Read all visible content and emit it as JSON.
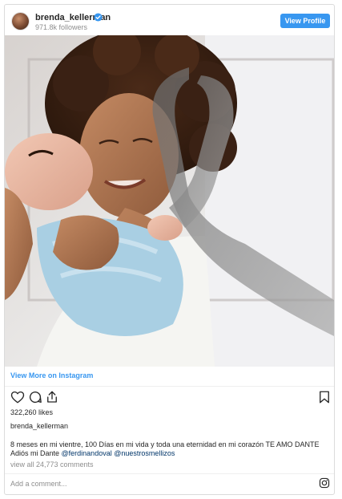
{
  "header": {
    "username": "brenda_kellerman",
    "followers": "971.8k followers",
    "view_profile_label": "View Profile",
    "verified_icon": "verified-badge-icon"
  },
  "post": {
    "view_more_label": "View More on Instagram",
    "likes": "322,260 likes",
    "author": "brenda_kellerman",
    "caption_text": "8 meses en mi vientre, 100 Días en mi vida y toda una eternidad en mi corazón TE AMO DANTE Adiós mi Dante ",
    "mention_1": "@ferdinandoval",
    "mention_2": "@nuestrosmellizos",
    "view_comments": "view all 24,773 comments",
    "comment_placeholder": "Add a comment..."
  },
  "icons": {
    "like": "heart-icon",
    "comment": "comment-icon",
    "share": "share-icon",
    "save": "bookmark-icon",
    "brand": "instagram-icon"
  },
  "colors": {
    "accent": "#3897f0",
    "text": "#262626",
    "muted": "#8e8e8e",
    "mention": "#003569",
    "border": "#dbdbdb"
  }
}
